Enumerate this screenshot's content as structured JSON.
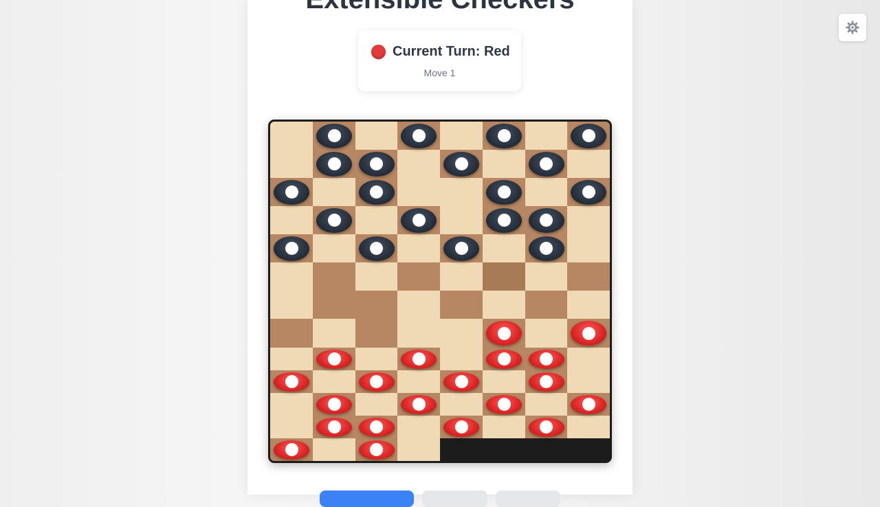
{
  "title": "Extensible Checkers",
  "status": {
    "turn_label": "Current Turn: Red",
    "move_label": "Move 1",
    "turn_color": "#e43a3a"
  },
  "board": {
    "cols": 8,
    "rows": 13,
    "colors": {
      "light": "#f0dab5",
      "dark": "#b68762",
      "highlight": "#a67b55",
      "black_piece": "#1f2733",
      "red_piece": "#e02828"
    },
    "cells": [
      "LDLDLDLD",
      "LDDLDLDL",
      "DLDLLDLD",
      "LDLDLDDL",
      "DLDLDLDL",
      "LDLDLHLD",
      "LDDLDLDL",
      "DLDLLDLD",
      "LDLDLDDL",
      "DLDLDLDL",
      "LDLDLDLD",
      "LDDLDLDL",
      "DLDLXXXX"
    ],
    "pieces": [
      {
        "r": 0,
        "c": 1,
        "color": "black"
      },
      {
        "r": 0,
        "c": 3,
        "color": "black"
      },
      {
        "r": 0,
        "c": 5,
        "color": "black"
      },
      {
        "r": 0,
        "c": 7,
        "color": "black"
      },
      {
        "r": 1,
        "c": 1,
        "color": "black"
      },
      {
        "r": 1,
        "c": 2,
        "color": "black"
      },
      {
        "r": 1,
        "c": 4,
        "color": "black"
      },
      {
        "r": 1,
        "c": 6,
        "color": "black"
      },
      {
        "r": 2,
        "c": 0,
        "color": "black"
      },
      {
        "r": 2,
        "c": 2,
        "color": "black"
      },
      {
        "r": 2,
        "c": 5,
        "color": "black"
      },
      {
        "r": 2,
        "c": 7,
        "color": "black"
      },
      {
        "r": 3,
        "c": 1,
        "color": "black"
      },
      {
        "r": 3,
        "c": 3,
        "color": "black"
      },
      {
        "r": 3,
        "c": 5,
        "color": "black"
      },
      {
        "r": 3,
        "c": 6,
        "color": "black"
      },
      {
        "r": 4,
        "c": 0,
        "color": "black"
      },
      {
        "r": 4,
        "c": 2,
        "color": "black"
      },
      {
        "r": 4,
        "c": 4,
        "color": "black"
      },
      {
        "r": 4,
        "c": 6,
        "color": "black"
      },
      {
        "r": 7,
        "c": 5,
        "color": "red"
      },
      {
        "r": 7,
        "c": 7,
        "color": "red"
      },
      {
        "r": 8,
        "c": 1,
        "color": "red"
      },
      {
        "r": 8,
        "c": 3,
        "color": "red"
      },
      {
        "r": 8,
        "c": 5,
        "color": "red"
      },
      {
        "r": 8,
        "c": 6,
        "color": "red"
      },
      {
        "r": 9,
        "c": 0,
        "color": "red"
      },
      {
        "r": 9,
        "c": 2,
        "color": "red"
      },
      {
        "r": 9,
        "c": 4,
        "color": "red"
      },
      {
        "r": 9,
        "c": 6,
        "color": "red"
      },
      {
        "r": 10,
        "c": 1,
        "color": "red"
      },
      {
        "r": 10,
        "c": 3,
        "color": "red"
      },
      {
        "r": 10,
        "c": 5,
        "color": "red"
      },
      {
        "r": 10,
        "c": 7,
        "color": "red"
      },
      {
        "r": 11,
        "c": 1,
        "color": "red"
      },
      {
        "r": 11,
        "c": 2,
        "color": "red"
      },
      {
        "r": 11,
        "c": 4,
        "color": "red"
      },
      {
        "r": 11,
        "c": 6,
        "color": "red"
      },
      {
        "r": 12,
        "c": 0,
        "color": "red"
      },
      {
        "r": 12,
        "c": 2,
        "color": "red"
      }
    ]
  },
  "buttons": [
    {
      "name": "primary-action-button",
      "label": "",
      "style": "primary"
    },
    {
      "name": "secondary-action-button",
      "label": "",
      "style": "secondary"
    },
    {
      "name": "tertiary-action-button",
      "label": "",
      "style": "secondary"
    }
  ],
  "icons": {
    "settings": "gear-icon"
  }
}
